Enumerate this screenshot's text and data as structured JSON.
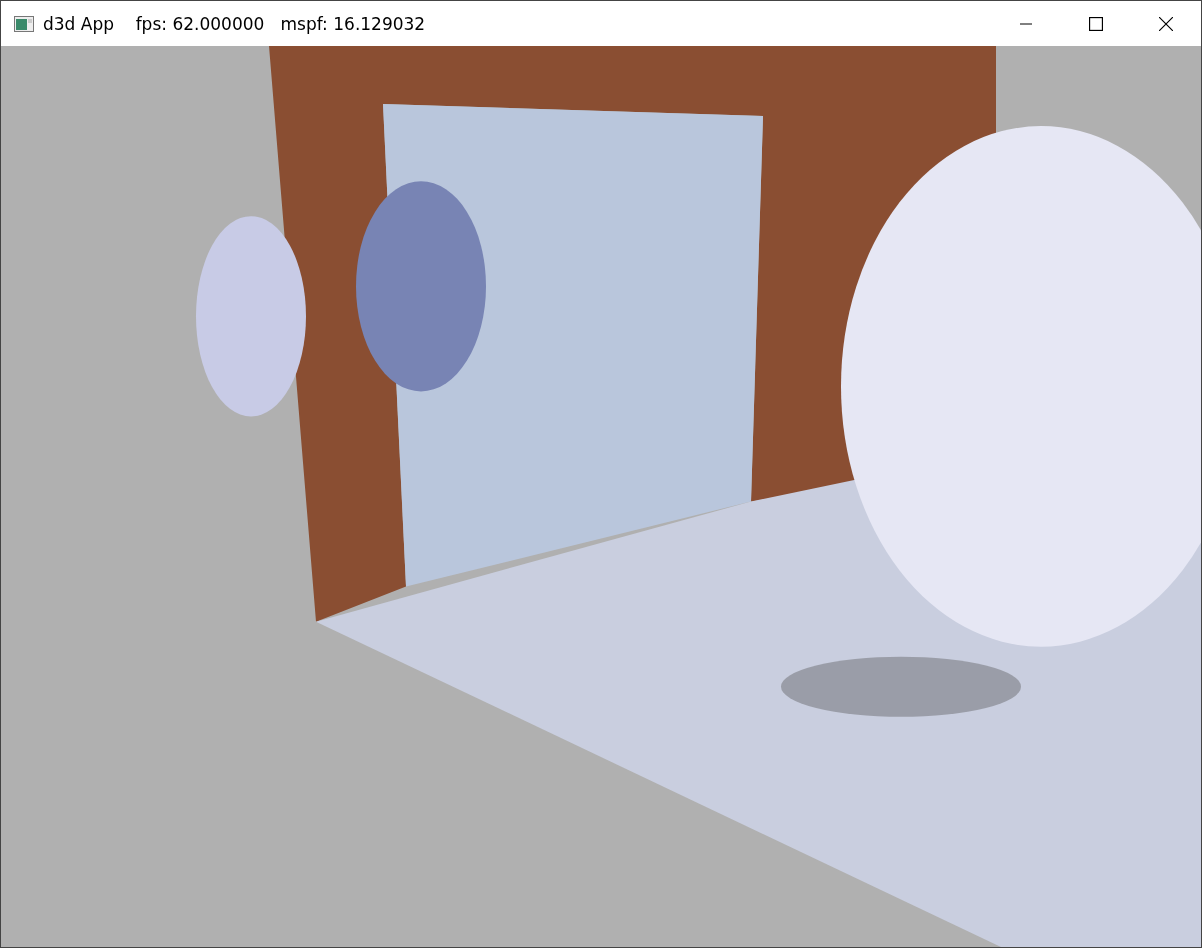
{
  "window": {
    "title": "d3d App    fps: 62.000000   mspf: 16.129032"
  }
}
